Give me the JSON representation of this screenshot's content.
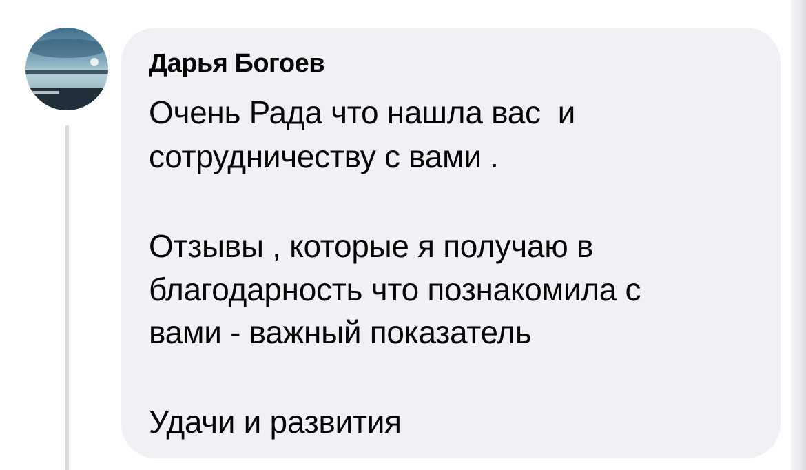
{
  "comment": {
    "author": "Дарья Богоев",
    "lines": [
      "Очень Рада что нашла вас  и",
      "сотрудничеству с вами .",
      "Отзывы , которые я получаю в",
      "благодарность что познакомила с",
      "вами - важный показатель",
      "Удачи и развития"
    ]
  },
  "colors": {
    "bubble": "#eff1f4",
    "text": "#050505",
    "thread_line": "#d8dadf"
  },
  "icons": {
    "avatar": "profile-photo-lake-landscape"
  }
}
